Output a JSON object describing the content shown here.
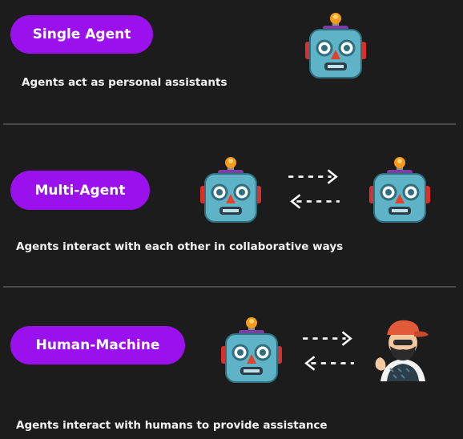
{
  "sections": [
    {
      "label": "Single Agent",
      "description": "Agents act as personal assistants",
      "icons": [
        "robot-icon"
      ]
    },
    {
      "label": "Multi-Agent",
      "description": "Agents interact with each other in collaborative ways",
      "icons": [
        "robot-icon",
        "exchange-arrows-icon",
        "robot-icon"
      ]
    },
    {
      "label": "Human-Machine",
      "description": "Agents interact with humans to provide assistance",
      "icons": [
        "robot-icon",
        "exchange-arrows-icon",
        "person-icon"
      ]
    }
  ],
  "colors": {
    "background": "#1c1c1c",
    "pill": "#9b11ee",
    "text": "#f2f2f2",
    "divider": "#4a4a4a"
  }
}
